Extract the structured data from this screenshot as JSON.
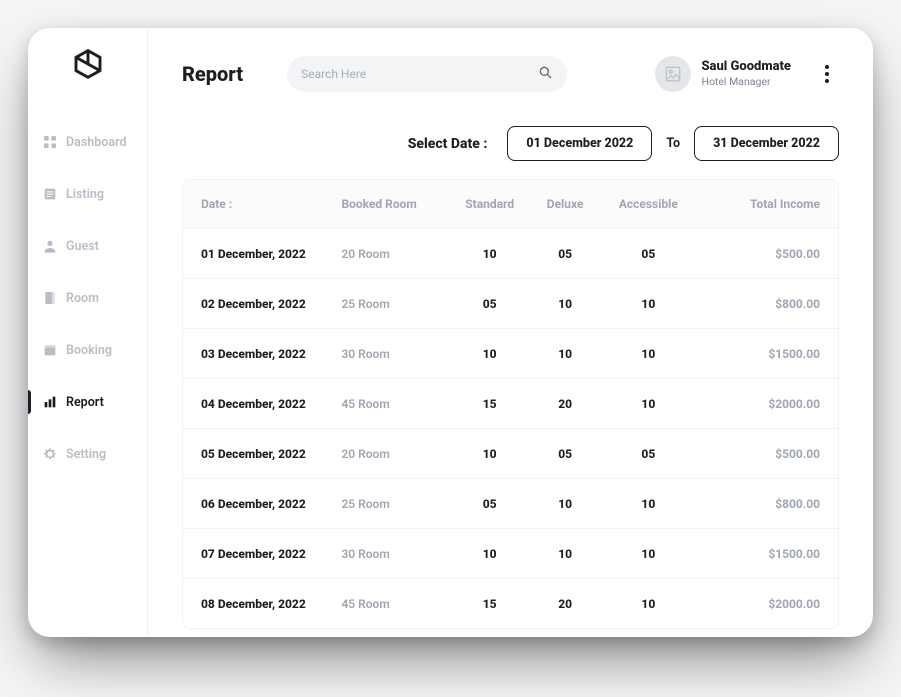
{
  "header": {
    "title": "Report",
    "search_placeholder": "Search Here"
  },
  "user": {
    "name": "Saul Goodmate",
    "role": "Hotel Manager"
  },
  "sidebar": {
    "items": [
      {
        "label": "Dashboard"
      },
      {
        "label": "Listing"
      },
      {
        "label": "Guest"
      },
      {
        "label": "Room"
      },
      {
        "label": "Booking"
      },
      {
        "label": "Report",
        "active": true
      },
      {
        "label": "Setting"
      }
    ]
  },
  "filter": {
    "label": "Select Date :",
    "from": "01 December 2022",
    "to_label": "To",
    "to": "31 December 2022"
  },
  "table": {
    "headers": {
      "date": "Date :",
      "booked": "Booked Room",
      "standard": "Standard",
      "deluxe": "Deluxe",
      "accessible": "Accessible",
      "income": "Total Income"
    },
    "rows": [
      {
        "date": "01 December, 2022",
        "booked": "20 Room",
        "standard": "10",
        "deluxe": "05",
        "accessible": "05",
        "income": "$500.00"
      },
      {
        "date": "02 December, 2022",
        "booked": "25 Room",
        "standard": "05",
        "deluxe": "10",
        "accessible": "10",
        "income": "$800.00"
      },
      {
        "date": "03 December, 2022",
        "booked": "30 Room",
        "standard": "10",
        "deluxe": "10",
        "accessible": "10",
        "income": "$1500.00"
      },
      {
        "date": "04 December, 2022",
        "booked": "45 Room",
        "standard": "15",
        "deluxe": "20",
        "accessible": "10",
        "income": "$2000.00"
      },
      {
        "date": "05 December, 2022",
        "booked": "20 Room",
        "standard": "10",
        "deluxe": "05",
        "accessible": "05",
        "income": "$500.00"
      },
      {
        "date": "06 December, 2022",
        "booked": "25 Room",
        "standard": "05",
        "deluxe": "10",
        "accessible": "10",
        "income": "$800.00"
      },
      {
        "date": "07 December, 2022",
        "booked": "30 Room",
        "standard": "10",
        "deluxe": "10",
        "accessible": "10",
        "income": "$1500.00"
      },
      {
        "date": "08 December, 2022",
        "booked": "45 Room",
        "standard": "15",
        "deluxe": "20",
        "accessible": "10",
        "income": "$2000.00"
      }
    ]
  }
}
